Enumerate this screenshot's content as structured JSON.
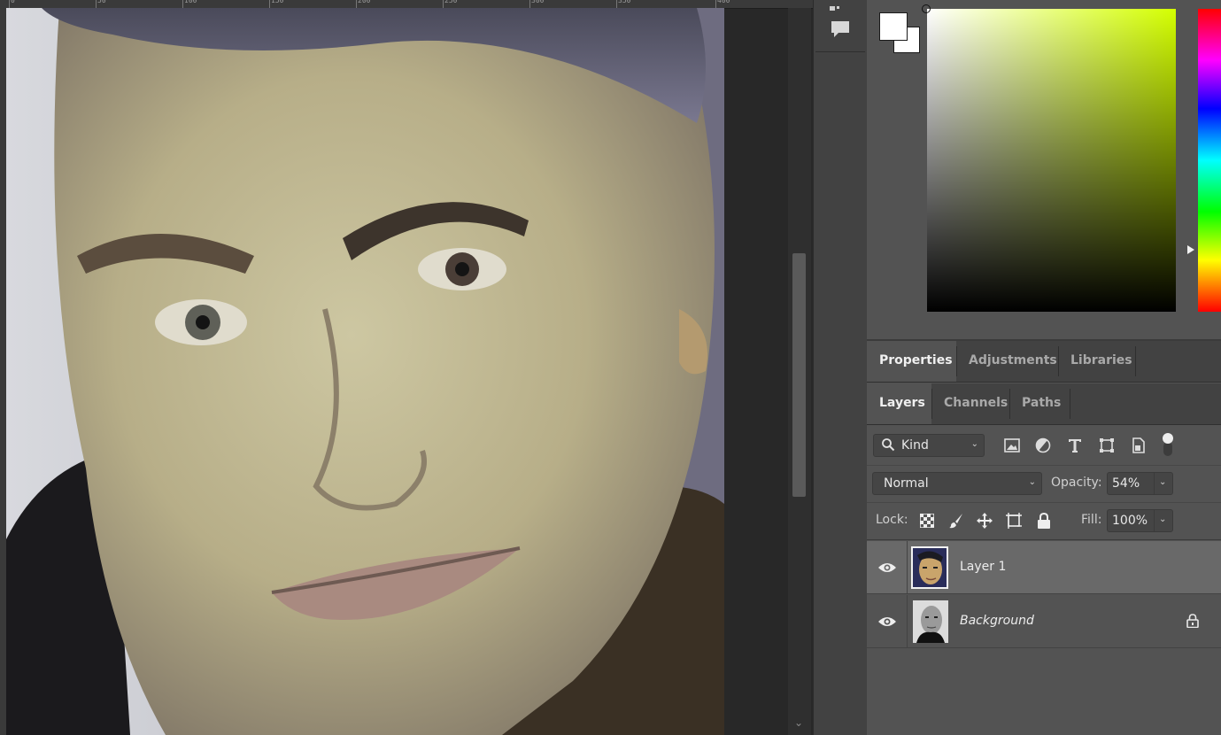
{
  "ruler": {
    "labels": [
      "0",
      "50",
      "100",
      "150",
      "200",
      "250",
      "300",
      "350",
      "400"
    ]
  },
  "toolbar": {
    "comment_icon": "speech-bubble-icon"
  },
  "color_panel": {
    "foreground": "#ffffff",
    "background": "#ffffff",
    "hue": "#d4ff00"
  },
  "properties_tabs": [
    {
      "label": "Properties",
      "active": true
    },
    {
      "label": "Adjustments",
      "active": false
    },
    {
      "label": "Libraries",
      "active": false
    }
  ],
  "layers_tabs": [
    {
      "label": "Layers",
      "active": true
    },
    {
      "label": "Channels",
      "active": false
    },
    {
      "label": "Paths",
      "active": false
    }
  ],
  "layers_panel": {
    "filter": {
      "kind_label": "Kind",
      "icons": [
        "image-filter-icon",
        "adjustment-filter-icon",
        "type-filter-icon",
        "shape-filter-icon",
        "smart-object-filter-icon"
      ]
    },
    "blend_mode": "Normal",
    "opacity_label": "Opacity:",
    "opacity_value": "54%",
    "lock_label": "Lock:",
    "lock_icons": [
      "lock-transparent-icon",
      "lock-image-icon",
      "lock-position-icon",
      "lock-artboard-icon",
      "lock-all-icon"
    ],
    "fill_label": "Fill:",
    "fill_value": "100%",
    "layers": [
      {
        "name": "Layer 1",
        "visible": true,
        "selected": true,
        "locked": false
      },
      {
        "name": "Background",
        "visible": true,
        "selected": false,
        "locked": true
      }
    ]
  }
}
